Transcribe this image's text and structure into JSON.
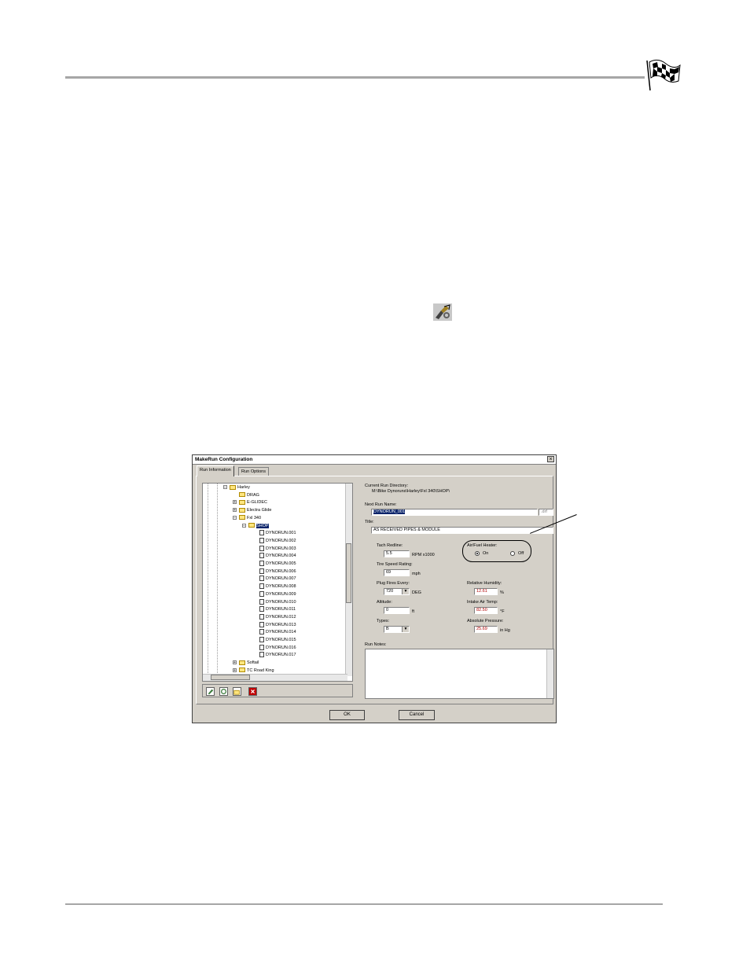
{
  "window": {
    "title": "MakeRun Configuration",
    "close_glyph": "×"
  },
  "tabs": [
    {
      "label": "Run Information"
    },
    {
      "label": "Run Options"
    }
  ],
  "tree": {
    "items": [
      {
        "label": "Harley",
        "depth": 0,
        "kind": "folder",
        "expander": "−"
      },
      {
        "label": "DRAG",
        "depth": 1,
        "kind": "folder",
        "expander": ""
      },
      {
        "label": "E-GLIDEC",
        "depth": 1,
        "kind": "folder",
        "expander": "+"
      },
      {
        "label": "Electra Glide",
        "depth": 1,
        "kind": "folder",
        "expander": "+"
      },
      {
        "label": "Fxl 340",
        "depth": 1,
        "kind": "folder",
        "expander": "−"
      },
      {
        "label": "SHOP",
        "depth": 2,
        "kind": "folder",
        "expander": "−",
        "selected": true
      },
      {
        "label": "DYNORUN.001",
        "depth": 3,
        "kind": "file"
      },
      {
        "label": "DYNORUN.002",
        "depth": 3,
        "kind": "file"
      },
      {
        "label": "DYNORUN.003",
        "depth": 3,
        "kind": "file"
      },
      {
        "label": "DYNORUN.004",
        "depth": 3,
        "kind": "file"
      },
      {
        "label": "DYNORUN.005",
        "depth": 3,
        "kind": "file"
      },
      {
        "label": "DYNORUN.006",
        "depth": 3,
        "kind": "file"
      },
      {
        "label": "DYNORUN.007",
        "depth": 3,
        "kind": "file"
      },
      {
        "label": "DYNORUN.008",
        "depth": 3,
        "kind": "file"
      },
      {
        "label": "DYNORUN.009",
        "depth": 3,
        "kind": "file"
      },
      {
        "label": "DYNORUN.010",
        "depth": 3,
        "kind": "file"
      },
      {
        "label": "DYNORUN.011",
        "depth": 3,
        "kind": "file"
      },
      {
        "label": "DYNORUN.012",
        "depth": 3,
        "kind": "file"
      },
      {
        "label": "DYNORUN.013",
        "depth": 3,
        "kind": "file"
      },
      {
        "label": "DYNORUN.014",
        "depth": 3,
        "kind": "file"
      },
      {
        "label": "DYNORUN.015",
        "depth": 3,
        "kind": "file"
      },
      {
        "label": "DYNORUN.016",
        "depth": 3,
        "kind": "file"
      },
      {
        "label": "DYNORUN.017",
        "depth": 3,
        "kind": "file"
      },
      {
        "label": "Softail",
        "depth": 1,
        "kind": "folder",
        "expander": "+"
      },
      {
        "label": "TC Road King",
        "depth": 1,
        "kind": "folder",
        "expander": "+"
      }
    ],
    "tool_icons": [
      "edit-icon",
      "refresh-icon",
      "new-folder-icon",
      "delete-icon"
    ]
  },
  "form": {
    "current_dir_label": "Current Run Directory:",
    "current_dir_value": "M:\\Bike Dynoruns\\Harley\\Fxl 340\\SHOP\\",
    "next_run_label": "Next Run Name:",
    "next_run_value": "DYNORUN_001",
    "next_run_ext": ".drf",
    "title_label": "Title:",
    "title_value": "AS RECEIVED PIPES & MODULE",
    "tach_label": "Tach Redline:",
    "tach_value": "5.5",
    "tach_unit": "RPM x1000",
    "tire_label": "Tire Speed Rating:",
    "tire_value": "69",
    "tire_unit": "mph",
    "plug_label": "Plug Fires Every:",
    "plug_value": "720",
    "plug_unit": "DEG",
    "altitude_label": "Altitude:",
    "altitude_value": "0",
    "altitude_unit": "ft",
    "types_label": "Types:",
    "types_value": "B",
    "heater_label": "Air/Fuel Heater:",
    "heater_on": "On",
    "heater_off": "Off",
    "heater_selected": "On",
    "humidity_label": "Relative Humidity:",
    "humidity_value": "12.61",
    "humidity_unit": "%",
    "intake_label": "Intake Air Temp:",
    "intake_value": "82.50",
    "intake_unit": "°F",
    "pressure_label": "Absolute Pressure:",
    "pressure_value": "25.69",
    "pressure_unit": "in Hg",
    "notes_label": "Run Notes:",
    "combo_arrow": "▼"
  },
  "buttons": {
    "ok": "OK",
    "cancel": "Cancel"
  },
  "colors": {
    "dialog_bg": "#d4d0c8",
    "selection": "#0a246a",
    "value_red": "#b00000"
  }
}
